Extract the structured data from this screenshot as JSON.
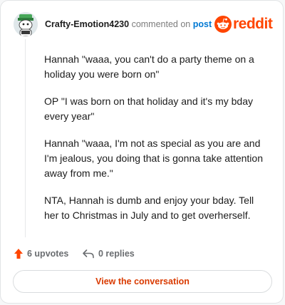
{
  "comment": {
    "username": "Crafty-Emotion4230",
    "action_text": " commented on ",
    "post_link": "post",
    "paragraphs": [
      "Hannah \"waaa, you can't do a party theme on a holiday you were born on\"",
      "OP \"I was born on that holiday and it's my bday every year\"",
      "Hannah \"waaa, I'm not as special as you are and I'm jealous, you doing that is gonna take attention away from me.\"",
      "NTA, Hannah is dumb and enjoy your bday. Tell her to Christmas in July and to get overherself."
    ]
  },
  "brand": {
    "name": "reddit",
    "icon": "reddit-snoo-icon",
    "color": "#ff4500"
  },
  "actions": {
    "upvotes_label": "6 upvotes",
    "replies_label": "0 replies",
    "upvote_icon": "upvote-arrow-icon",
    "reply_icon": "reply-arrow-icon",
    "upvote_color": "#ff4500"
  },
  "cta": {
    "label": "View the conversation",
    "color": "#d93a00"
  }
}
